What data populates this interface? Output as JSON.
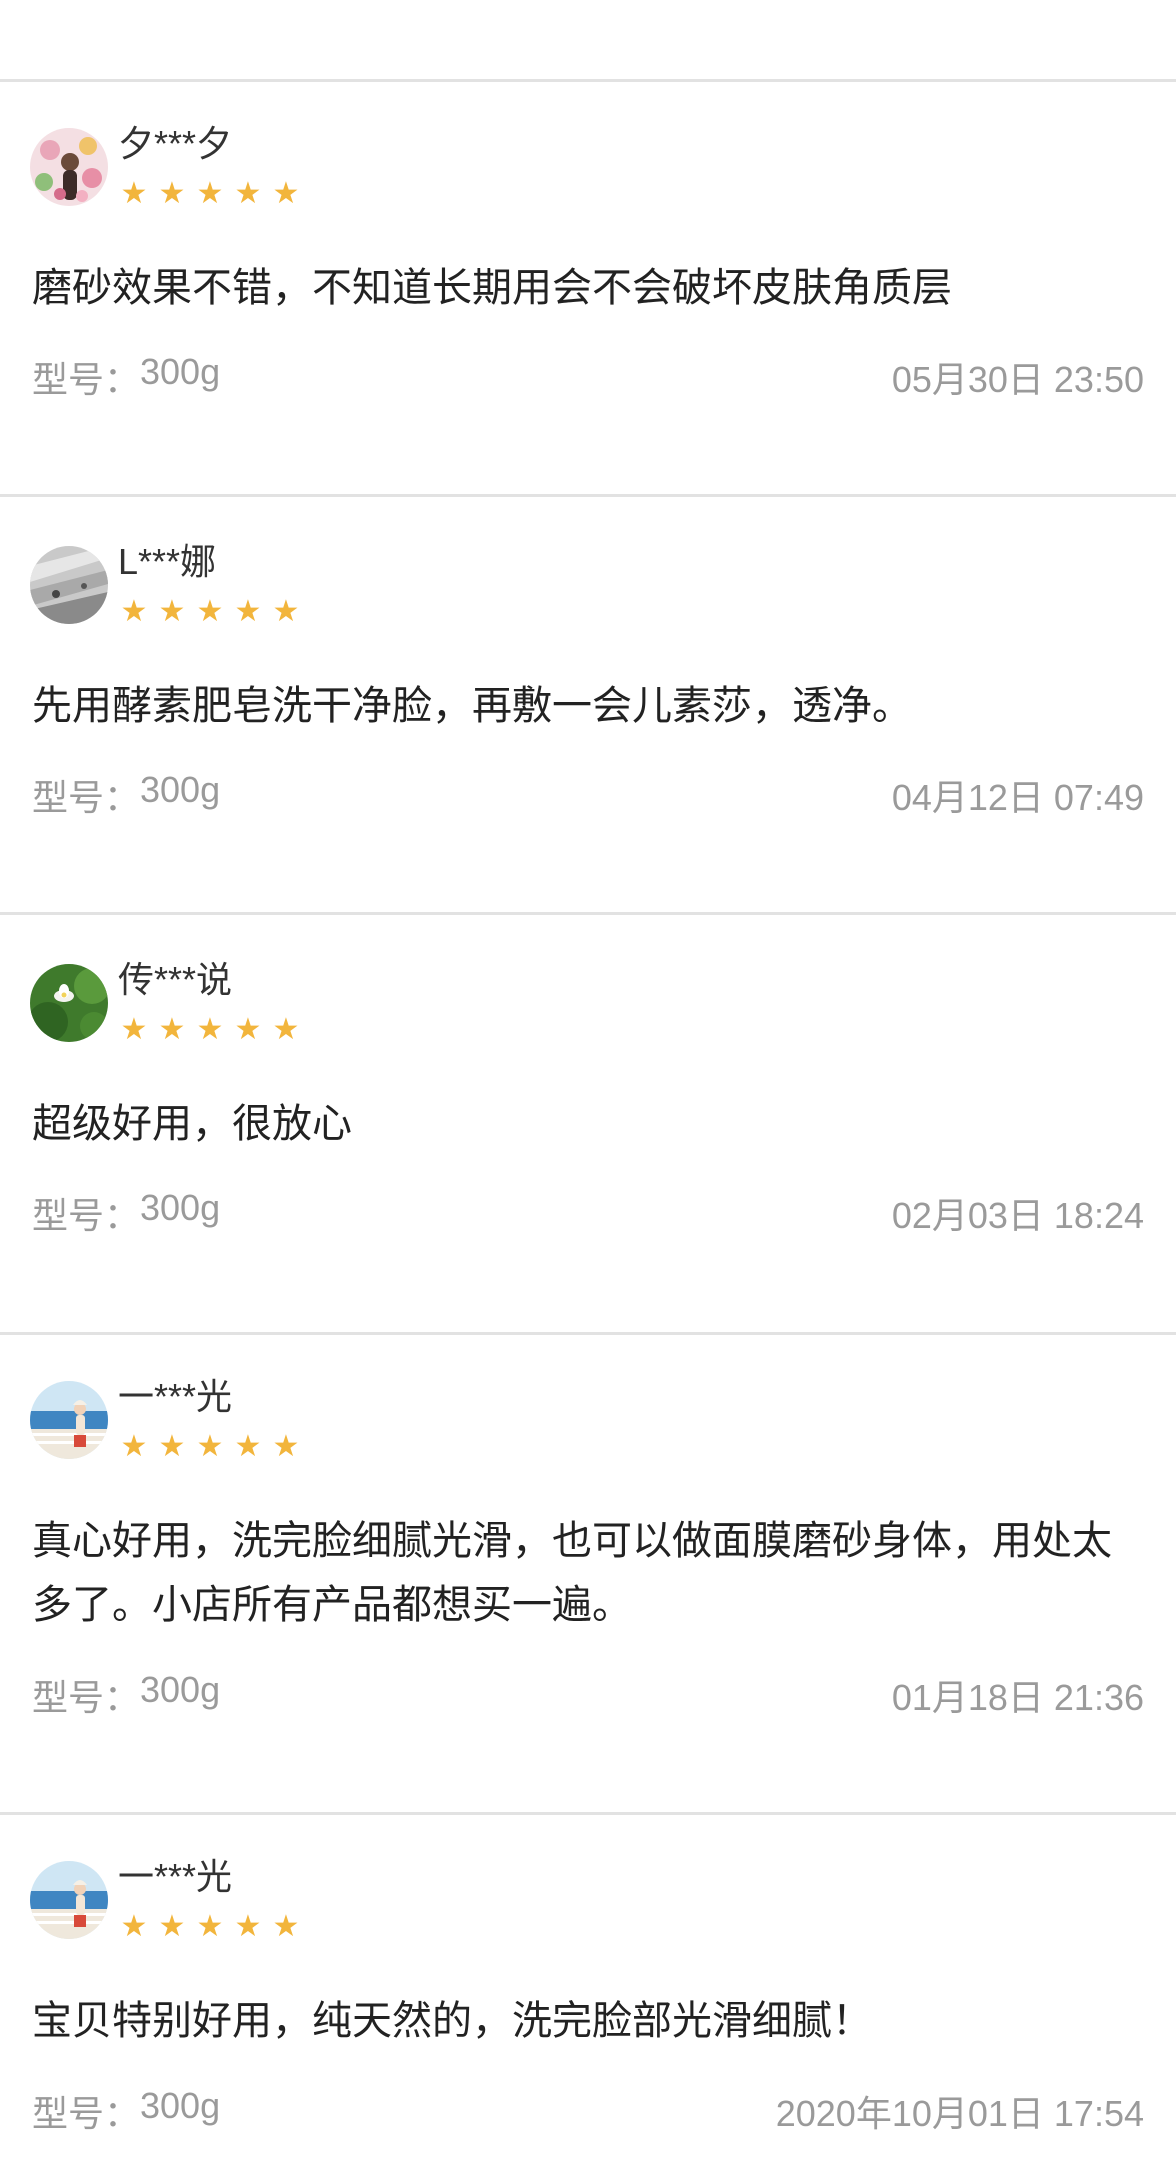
{
  "reviews": [
    {
      "username": "夕***夕",
      "rating": 5,
      "avatar_icon": "flower-portrait-avatar",
      "content": "磨砂效果不错，不知道长期用会不会破坏皮肤角质层",
      "model_label": "型号：",
      "model_value": "300g",
      "date": "05月30日 23:50"
    },
    {
      "username": "L***娜",
      "rating": 5,
      "avatar_icon": "gray-abstract-avatar",
      "content": "先用酵素肥皂洗干净脸，再敷一会儿素莎，透净。",
      "model_label": "型号：",
      "model_value": "300g",
      "date": "04月12日 07:49"
    },
    {
      "username": "传***说",
      "rating": 5,
      "avatar_icon": "lotus-avatar",
      "content": "超级好用，很放心",
      "model_label": "型号：",
      "model_value": "300g",
      "date": "02月03日 18:24"
    },
    {
      "username": "一***光",
      "rating": 5,
      "avatar_icon": "seaside-girl-avatar",
      "content": "真心好用，洗完脸细腻光滑，也可以做面膜磨砂身体，用处太多了。小店所有产品都想买一遍。",
      "model_label": "型号：",
      "model_value": "300g",
      "date": "01月18日 21:36"
    },
    {
      "username": "一***光",
      "rating": 5,
      "avatar_icon": "seaside-girl-avatar",
      "content": "宝贝特别好用，纯天然的，洗完脸部光滑细腻！",
      "model_label": "型号：",
      "model_value": "300g",
      "date": "2020年10月01日 17:54"
    }
  ],
  "colors": {
    "star": "#f2b53c",
    "meta_text": "#9a9a9a",
    "divider": "#e2e2e2",
    "body_text": "#222222"
  },
  "icons": {
    "star": "★"
  }
}
